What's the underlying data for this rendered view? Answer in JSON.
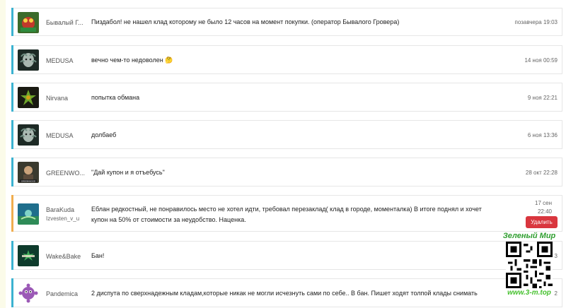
{
  "messages": [
    {
      "user": "Бывалый Г...",
      "user2": "",
      "text": "Пиздабол! не нашел клад которому не было 12 часов на момент покупки. (оператор Бывалого Гровера)",
      "text2": "",
      "time": "позавчера 19:03",
      "time2": "",
      "avatar": "frog-avatar-icon",
      "bar": "#3bb2d0"
    },
    {
      "user": "MEDUSA",
      "user2": "",
      "text": "вечно чем-то недоволен 🤔",
      "text2": "",
      "time": "14 ноя 00:59",
      "time2": "",
      "avatar": "medusa-avatar-icon",
      "bar": "#3bb2d0"
    },
    {
      "user": "Nirvana",
      "user2": "",
      "text": "попытка обмана",
      "text2": "",
      "time": "9 ноя 22:21",
      "time2": "",
      "avatar": "nirvana-avatar-icon",
      "bar": "#3bb2d0"
    },
    {
      "user": "MEDUSA",
      "user2": "",
      "text": "долбаеб",
      "text2": "",
      "time": "6 ноя 13:36",
      "time2": "",
      "avatar": "medusa-avatar-icon",
      "bar": "#3bb2d0"
    },
    {
      "user": "GREENWO...",
      "user2": "",
      "text": "\"Дай купон и я отъебусь\"",
      "text2": "",
      "time": "28 окт 22:28",
      "time2": "",
      "avatar": "greenwood-avatar-icon",
      "bar": "#3bb2d0"
    },
    {
      "user": "BaraKuda",
      "user2": "Izvesten_v_u",
      "text": "Еблан редкостный, не понравилось место не хотел идти, требовал перезаклад( клад в городе, моменталка) В итоге поднял и хочет",
      "text2": "купон на 50% от стоимости за неудобство. Наценка.",
      "time": "17 сен",
      "time2": "22:40",
      "avatar": "barakuda-avatar-icon",
      "bar": "#f0ad4e",
      "delete_label": "Удалить"
    },
    {
      "user": "Wake&Bake",
      "user2": "",
      "text": "Бан!",
      "text2": "",
      "time": "3",
      "time2": "",
      "avatar": "wakebake-avatar-icon",
      "bar": "#3bb2d0"
    },
    {
      "user": "Pandemica",
      "user2": "",
      "text": "2 диспута по сверхнадежным кладам,которые никак не могли исчезнуть сами по себе.. В бан. Пишет ходят толпой клады снимать",
      "text2": "",
      "time": "2",
      "time2": "",
      "avatar": "pandemica-avatar-icon",
      "bar": "#3bb2d0"
    }
  ],
  "watermark": {
    "title": "Зеленый Мир",
    "url": "www.3-m.top"
  }
}
